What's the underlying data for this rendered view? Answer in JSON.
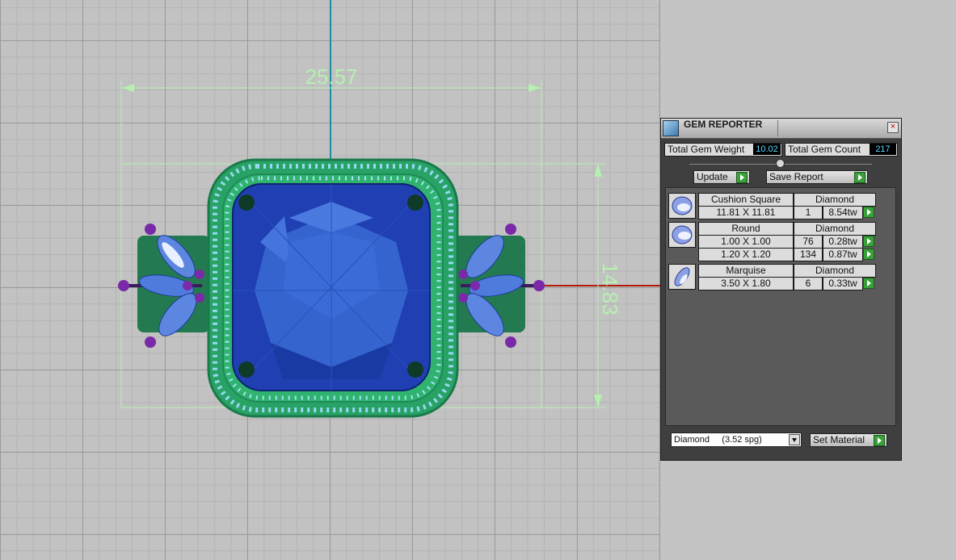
{
  "viewport": {
    "dimensions": {
      "width": "25.57",
      "height": "14.83"
    }
  },
  "panel": {
    "title": "GEM REPORTER",
    "close_label": "×",
    "total_weight_label": "Total Gem Weight",
    "total_weight_value": "10.02",
    "total_count_label": "Total Gem Count",
    "total_count_value": "217",
    "update_label": "Update",
    "save_report_label": "Save Report",
    "groups": [
      {
        "shape": "Cushion Square",
        "material": "Diamond",
        "rows": [
          {
            "size": "11.81 X 11.81",
            "count": "1",
            "weight": "8.54tw"
          }
        ]
      },
      {
        "shape": "Round",
        "material": "Diamond",
        "rows": [
          {
            "size": "1.00 X 1.00",
            "count": "76",
            "weight": "0.28tw"
          },
          {
            "size": "1.20 X 1.20",
            "count": "134",
            "weight": "0.87tw"
          }
        ]
      },
      {
        "shape": "Marquise",
        "material": "Diamond",
        "rows": [
          {
            "size": "3.50 X 1.80",
            "count": "6",
            "weight": "0.33tw"
          }
        ]
      }
    ],
    "material_select_value": "Diamond     (3.52 spg)",
    "set_material_label": "Set Material"
  },
  "colors": {
    "dimension_line": "#b6f0b0",
    "gem_blue": "#2c56c7",
    "halo_green": "#2fb36f",
    "prong_purple": "#7a2aa8",
    "axis_blue": "#1b8fa0",
    "axis_red": "#b21a0a",
    "go_button": "#3aa13a"
  }
}
